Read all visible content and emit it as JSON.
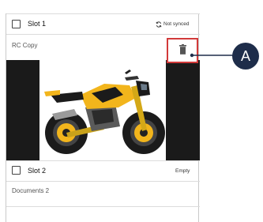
{
  "slot1": {
    "label": "Slot 1",
    "status": "Not synced",
    "subtitle": "RC Copy"
  },
  "slot2": {
    "label": "Slot 2",
    "status": "Empty",
    "subtitle": "Documents 2"
  },
  "callout": {
    "letter": "A"
  },
  "colors": {
    "highlight": "#d23a3a",
    "callout_bg": "#1e2d4a",
    "bike_accent": "#f2b51c"
  },
  "icons": [
    "sync-icon",
    "trash-icon",
    "checkbox"
  ]
}
